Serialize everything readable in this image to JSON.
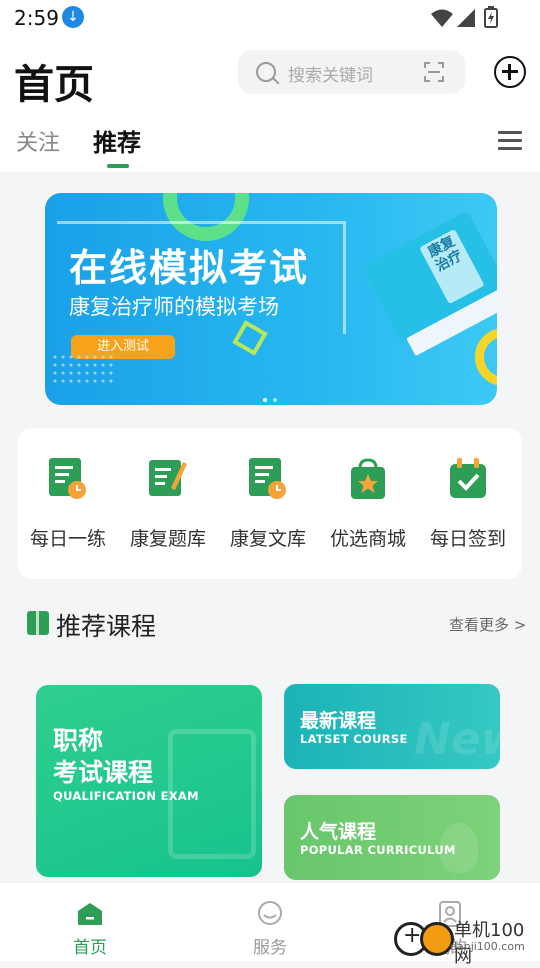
{
  "status_bar": {
    "time": "2:59",
    "download_icon": "download-arrow-icon"
  },
  "header": {
    "title": "首页",
    "search_placeholder": "搜索关键词",
    "tabs": [
      {
        "label": "关注",
        "active": false
      },
      {
        "label": "推荐",
        "active": true
      }
    ]
  },
  "banner": {
    "title": "在线模拟考试",
    "subtitle": "康复治疗师的模拟考场",
    "button": "进入测试",
    "book_text": "康复治疗",
    "page_count": 2,
    "active_page": 1
  },
  "quick_menu": [
    {
      "label": "每日一练",
      "icon": "clock-document-icon"
    },
    {
      "label": "康复题库",
      "icon": "pencil-document-icon"
    },
    {
      "label": "康复文库",
      "icon": "clock-document-icon"
    },
    {
      "label": "优选商城",
      "icon": "shopping-bag-star-icon"
    },
    {
      "label": "每日签到",
      "icon": "calendar-check-icon"
    }
  ],
  "section": {
    "title": "推荐课程",
    "more": "查看更多 >"
  },
  "courses": {
    "qualification": {
      "line1": "职称",
      "line2": "考试课程",
      "en": "QUALIFICATION EXAM"
    },
    "latest": {
      "title": "最新课程",
      "en": "LATSET COURSE",
      "deco": "New"
    },
    "popular": {
      "title": "人气课程",
      "en": "POPULAR CURRICULUM"
    }
  },
  "bottom_nav": [
    {
      "label": "首页",
      "active": true,
      "icon": "home-icon"
    },
    {
      "label": "服务",
      "active": false,
      "icon": "chat-service-icon"
    },
    {
      "label": "我的",
      "active": false,
      "icon": "profile-icon"
    }
  ],
  "watermark": {
    "name": "单机100网",
    "url": "danji100.com"
  },
  "colors": {
    "accent": "#2e9e57",
    "banner_blue": "#1aa0e8",
    "button_orange": "#f7a21b"
  }
}
